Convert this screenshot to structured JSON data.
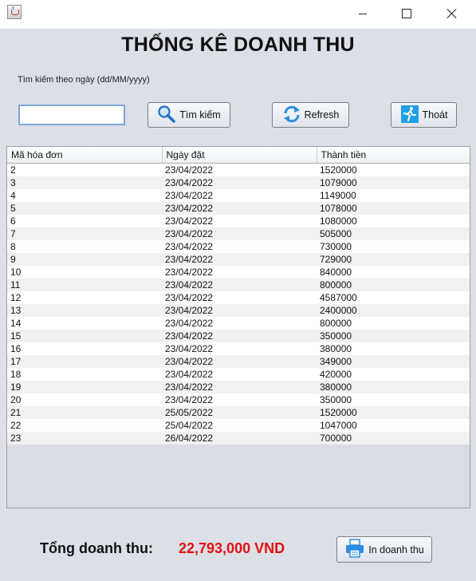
{
  "window": {
    "title": ""
  },
  "page_title": "THỐNG KÊ DOANH THU",
  "search": {
    "label": "Tìm kiếm theo ngày (dd/MM/yyyy)",
    "value": "",
    "button_label": "Tìm kiếm",
    "icon": "magnifier-icon"
  },
  "refresh": {
    "label": "Refresh",
    "icon": "refresh-arrows-icon"
  },
  "exit": {
    "label": "Thoát",
    "icon": "running-exit-icon"
  },
  "table": {
    "columns": [
      "Mã hóa đơn",
      "Ngày đặt",
      "Thành tiền"
    ],
    "rows": [
      [
        "2",
        "23/04/2022",
        "1520000"
      ],
      [
        "3",
        "23/04/2022",
        "1079000"
      ],
      [
        "4",
        "23/04/2022",
        "1149000"
      ],
      [
        "5",
        "23/04/2022",
        "1078000"
      ],
      [
        "6",
        "23/04/2022",
        "1080000"
      ],
      [
        "7",
        "23/04/2022",
        "505000"
      ],
      [
        "8",
        "23/04/2022",
        "730000"
      ],
      [
        "9",
        "23/04/2022",
        "729000"
      ],
      [
        "10",
        "23/04/2022",
        "840000"
      ],
      [
        "11",
        "23/04/2022",
        "800000"
      ],
      [
        "12",
        "23/04/2022",
        "4587000"
      ],
      [
        "13",
        "23/04/2022",
        "2400000"
      ],
      [
        "14",
        "23/04/2022",
        "800000"
      ],
      [
        "15",
        "23/04/2022",
        "350000"
      ],
      [
        "16",
        "23/04/2022",
        "380000"
      ],
      [
        "17",
        "23/04/2022",
        "349000"
      ],
      [
        "18",
        "23/04/2022",
        "420000"
      ],
      [
        "19",
        "23/04/2022",
        "380000"
      ],
      [
        "20",
        "23/04/2022",
        "350000"
      ],
      [
        "21",
        "25/05/2022",
        "1520000"
      ],
      [
        "22",
        "25/04/2022",
        "1047000"
      ],
      [
        "23",
        "26/04/2022",
        "700000"
      ]
    ]
  },
  "total": {
    "label": "Tổng doanh thu:",
    "value": "22,793,000 VND",
    "color": "#e01010"
  },
  "print": {
    "label": "In doanh thu",
    "icon": "printer-icon"
  }
}
